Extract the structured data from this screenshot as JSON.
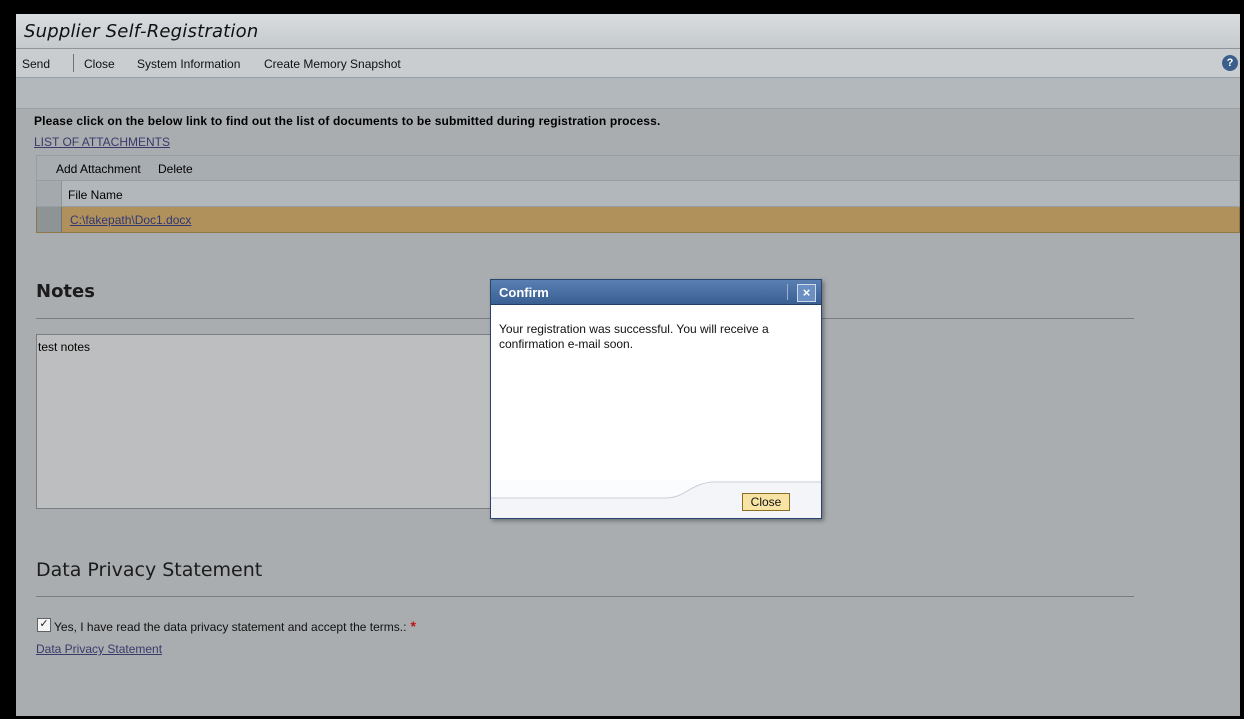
{
  "app": {
    "title": "Supplier Self-Registration"
  },
  "toolbar": {
    "send": "Send",
    "close": "Close",
    "system_information": "System Information",
    "create_memory_snapshot": "Create Memory Snapshot",
    "help_icon": "?"
  },
  "content": {
    "instruction": "Please click on the below link to find out the list of documents to be submitted during registration process.",
    "list_link": "LIST OF ATTACHMENTS",
    "attachments": {
      "add_attachment": "Add Attachment",
      "delete": "Delete",
      "column_file_name": "File Name",
      "rows": [
        {
          "file_name": "C:\\fakepath\\Doc1.docx"
        }
      ]
    },
    "notes": {
      "title": "Notes",
      "text": "test notes"
    },
    "privacy": {
      "title": "Data Privacy Statement",
      "checkbox_label": "Yes, I have read the data privacy statement and accept the terms.:",
      "checked": true,
      "required_mark": "*",
      "link": "Data Privacy Statement"
    }
  },
  "dialog": {
    "title": "Confirm",
    "close_icon": "×",
    "message": "Your registration was successful. You will receive a confirmation e-mail soon.",
    "close_button": "Close"
  },
  "colors": {
    "selected_row": "#b0915b",
    "dialog_header": "#3a5f92",
    "button_bg": "#f7e3a3",
    "required": "#c1121a"
  }
}
